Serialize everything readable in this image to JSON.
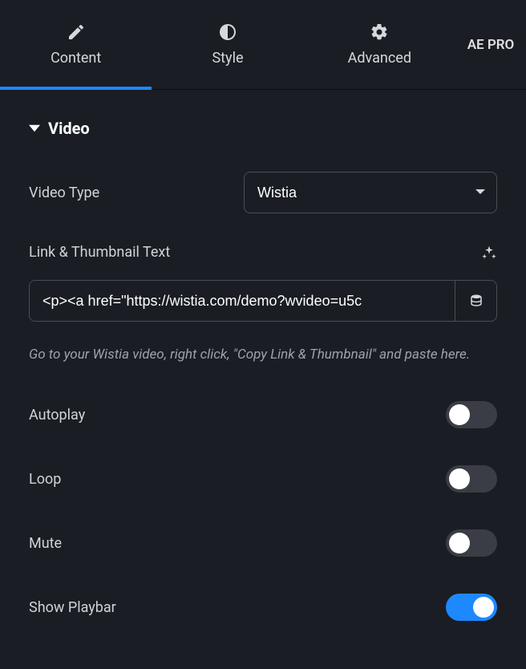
{
  "tabs": {
    "content": "Content",
    "style": "Style",
    "advanced": "Advanced",
    "badge": "AE PRO"
  },
  "section": {
    "title": "Video"
  },
  "fields": {
    "video_type_label": "Video Type",
    "video_type_value": "Wistia",
    "link_thumbnail_label": "Link & Thumbnail Text",
    "link_thumbnail_value": "<p><a href=\"https://wistia.com/demo?wvideo=u5c",
    "hint": "Go to your Wistia video, right click, \"Copy Link & Thumbnail\" and paste here.",
    "autoplay_label": "Autoplay",
    "loop_label": "Loop",
    "mute_label": "Mute",
    "playbar_label": "Show Playbar"
  },
  "toggles": {
    "autoplay": false,
    "loop": false,
    "mute": false,
    "playbar": true
  }
}
